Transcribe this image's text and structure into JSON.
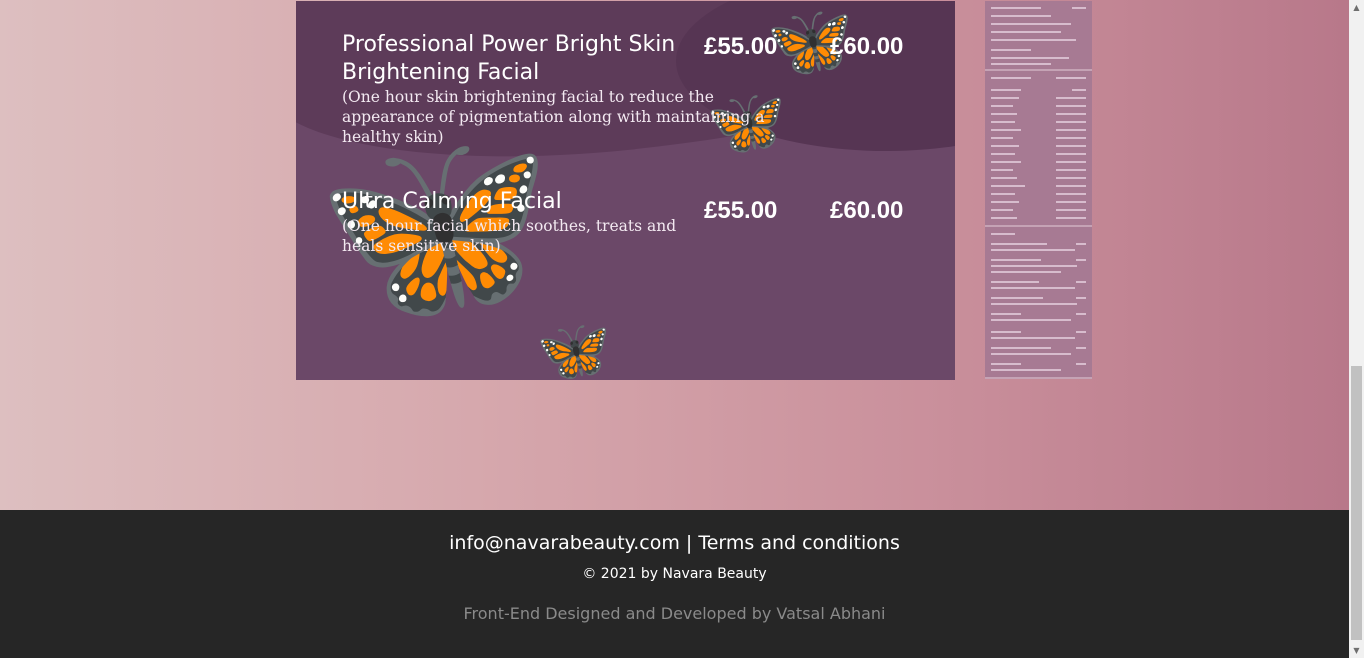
{
  "menu": {
    "items": [
      {
        "title": "Professional Power Bright Skin Brightening Facial",
        "description": "(One hour skin brightening facial to reduce the appearance of pigmentation along with maintaining a healthy skin)",
        "price_1": "£55.00",
        "price_2": "£60.00"
      },
      {
        "title": "Ultra Calming Facial",
        "description": "(One hour facial which soothes, treats and heals sensitive skin)",
        "price_1": "£55.00",
        "price_2": "£60.00"
      }
    ],
    "decoration_icon": "butterfly-icon",
    "card_color": "#6b4868"
  },
  "footer": {
    "email": "info@navarabeauty.com",
    "separator": "|",
    "terms": "Terms and conditions",
    "copyright": "© 2021 by Navara Beauty",
    "credit": "Front-End Designed and Developed by Vatsal Abhani",
    "background": "#262626"
  },
  "scrollbar": {
    "up_icon": "▲",
    "down_icon": "▼"
  }
}
